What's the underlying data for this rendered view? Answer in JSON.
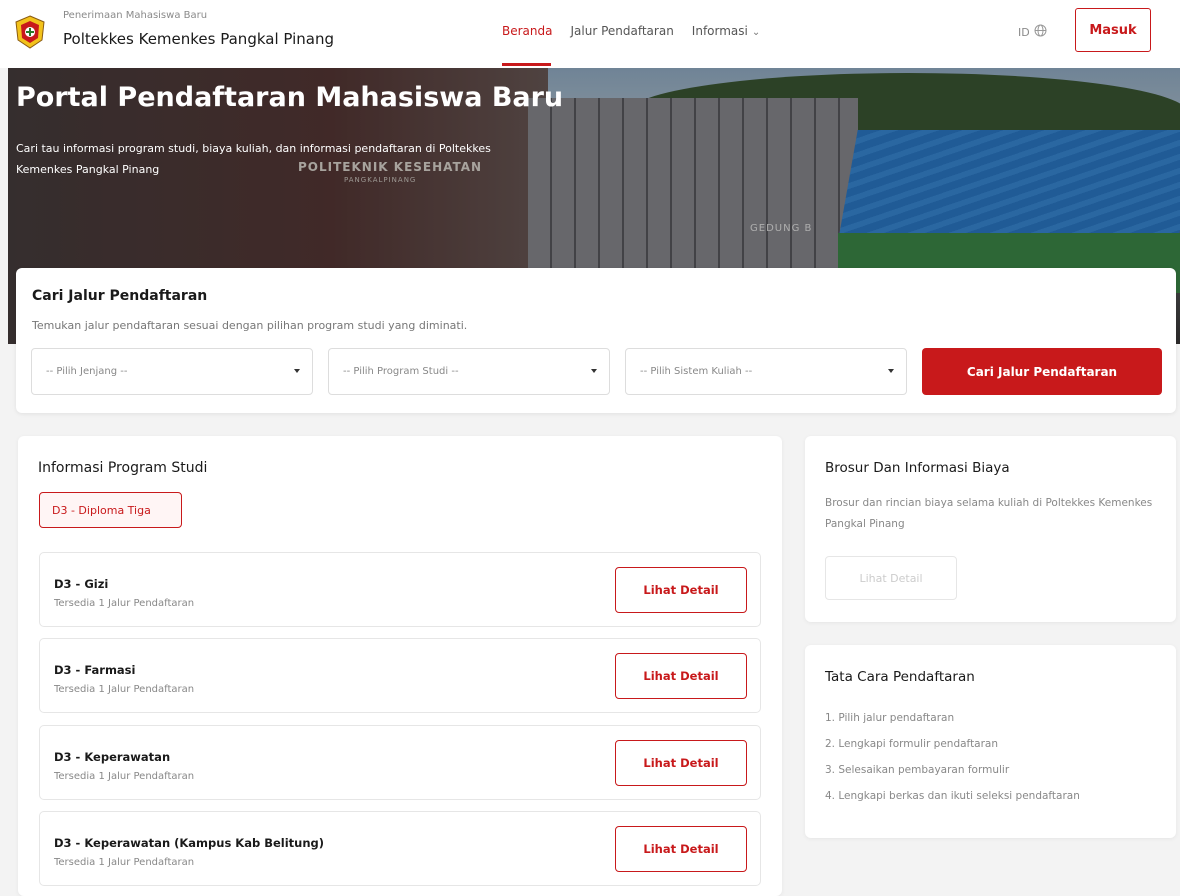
{
  "header": {
    "brand_small": "Penerimaan Mahasiswa Baru",
    "brand_main": "Poltekkes Kemenkes Pangkal Pinang",
    "nav": [
      {
        "label": "Beranda"
      },
      {
        "label": "Jalur Pendaftaran"
      },
      {
        "label": "Informasi"
      }
    ],
    "lang": "ID",
    "login_label": "Masuk",
    "accent_color": "#c8191b"
  },
  "hero": {
    "title": "Portal Pendaftaran Mahasiswa Baru",
    "subtitle": "Cari tau informasi program studi, biaya kuliah, dan informasi pendaftaran di Poltekkes Kemenkes Pangkal Pinang",
    "sign_text": "POLITEKNIK KESEHATAN",
    "sign_subtext": "PANGKALPINANG",
    "building_label": "GEDUNG B"
  },
  "search": {
    "title": "Cari Jalur Pendaftaran",
    "description": "Temukan jalur pendaftaran sesuai dengan pilihan program studi yang diminati.",
    "selects": [
      {
        "value": "-- Pilih Jenjang --"
      },
      {
        "value": "-- Pilih Program Studi --"
      },
      {
        "value": "-- Pilih Sistem Kuliah --"
      }
    ],
    "button_label": "Cari Jalur Pendaftaran"
  },
  "program": {
    "title": "Informasi Program Studi",
    "active_tag": "D3 - Diploma Tiga",
    "rows": [
      {
        "name": "D3 - Gizi",
        "sub": "Tersedia 1 Jalur Pendaftaran",
        "button": "Lihat Detail"
      },
      {
        "name": "D3 - Farmasi",
        "sub": "Tersedia 1 Jalur Pendaftaran",
        "button": "Lihat Detail"
      },
      {
        "name": "D3 - Keperawatan",
        "sub": "Tersedia 1 Jalur Pendaftaran",
        "button": "Lihat Detail"
      },
      {
        "name": "D3 - Keperawatan (Kampus Kab Belitung)",
        "sub": "Tersedia 1 Jalur Pendaftaran",
        "button": "Lihat Detail"
      }
    ]
  },
  "brosur": {
    "title": "Brosur Dan Informasi Biaya",
    "description": "Brosur dan rincian biaya selama kuliah di Poltekkes Kemenkes Pangkal Pinang",
    "button": "Lihat Detail"
  },
  "tata_cara": {
    "title": "Tata Cara Pendaftaran",
    "steps": [
      "1. Pilih jalur pendaftaran",
      "2. Lengkapi formulir pendaftaran",
      "3. Selesaikan pembayaran formulir",
      "4. Lengkapi berkas dan ikuti seleksi pendaftaran"
    ]
  }
}
